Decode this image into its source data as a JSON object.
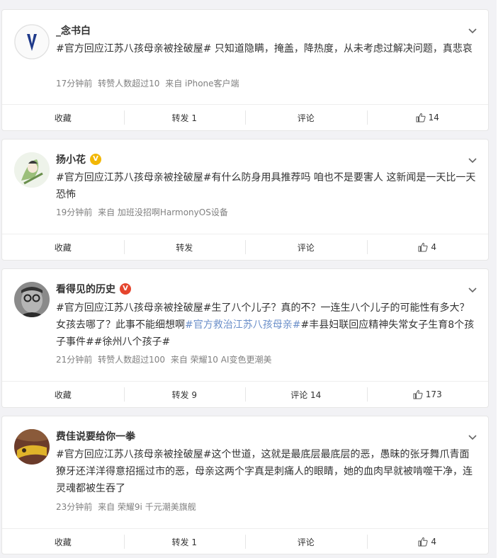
{
  "posts": [
    {
      "username": "_念书白",
      "verified": "",
      "segments": [
        {
          "text": "#官方回应江苏八孩母亲被拴破屋#",
          "kind": "tag"
        },
        {
          "text": " 只知道隐瞒，掩盖，降热度，从未考虑过解决问题，真悲哀",
          "kind": "text"
        }
      ],
      "meta": {
        "time": "17分钟前",
        "extra": "转赞人数超过10",
        "source": "来自 iPhone客户端"
      },
      "actions": {
        "favorite": "收藏",
        "repost": "转发 1",
        "comment": "评论",
        "like": "14"
      }
    },
    {
      "username": "扬小花",
      "verified": "gold",
      "segments": [
        {
          "text": "#官方回应江苏八孩母亲被拴破屋#",
          "kind": "tag"
        },
        {
          "text": "有什么防身用具推荐吗 咱也不是要害人 这新闻是一天比一天恐怖",
          "kind": "text"
        }
      ],
      "meta": {
        "time": "19分钟前",
        "extra": "",
        "source": "来自 加班没招啊HarmonyOS设备"
      },
      "actions": {
        "favorite": "收藏",
        "repost": "转发",
        "comment": "评论",
        "like": "4"
      }
    },
    {
      "username": "看得见的历史",
      "verified": "red",
      "segments": [
        {
          "text": "#官方回应江苏八孩母亲被拴破屋#",
          "kind": "tag"
        },
        {
          "text": "生了八个儿子？真的不？一连生八个儿子的可能性有多大？女孩去哪了？此事不能细想啊",
          "kind": "text"
        },
        {
          "text": "#官方救治江苏八孩母亲#",
          "kind": "link"
        },
        {
          "text": "#丰县妇联回应精神失常女子生育8个孩子事件#",
          "kind": "tag"
        },
        {
          "text": "#徐州八个孩子#",
          "kind": "tag"
        }
      ],
      "meta": {
        "time": "21分钟前",
        "extra": "转赞人数超过100",
        "source": "来自 荣耀10 AI变色更潮美"
      },
      "actions": {
        "favorite": "收藏",
        "repost": "转发 9",
        "comment": "评论 14",
        "like": "173"
      }
    },
    {
      "username": "费佳说要给你一拳",
      "verified": "",
      "segments": [
        {
          "text": "#官方回应江苏八孩母亲被拴破屋#",
          "kind": "tag"
        },
        {
          "text": "这个世道，这就是最底层最底层的恶，愚昧的张牙舞爪青面獠牙还洋洋得意招摇过市的恶，母亲这两个字真是刺痛人的眼睛，她的血肉早就被啃噬干净，连灵魂都被生吞了",
          "kind": "text"
        }
      ],
      "meta": {
        "time": "23分钟前",
        "extra": "",
        "source": "来自 荣耀9i 千元潮美旗舰"
      },
      "actions": {
        "favorite": "收藏",
        "repost": "转发 1",
        "comment": "评论",
        "like": "4"
      }
    }
  ],
  "badge_glyph": "V",
  "colors": {
    "tag_link": "#6b8fc9",
    "verified_gold": "#f2b705",
    "verified_red": "#e5452e"
  }
}
